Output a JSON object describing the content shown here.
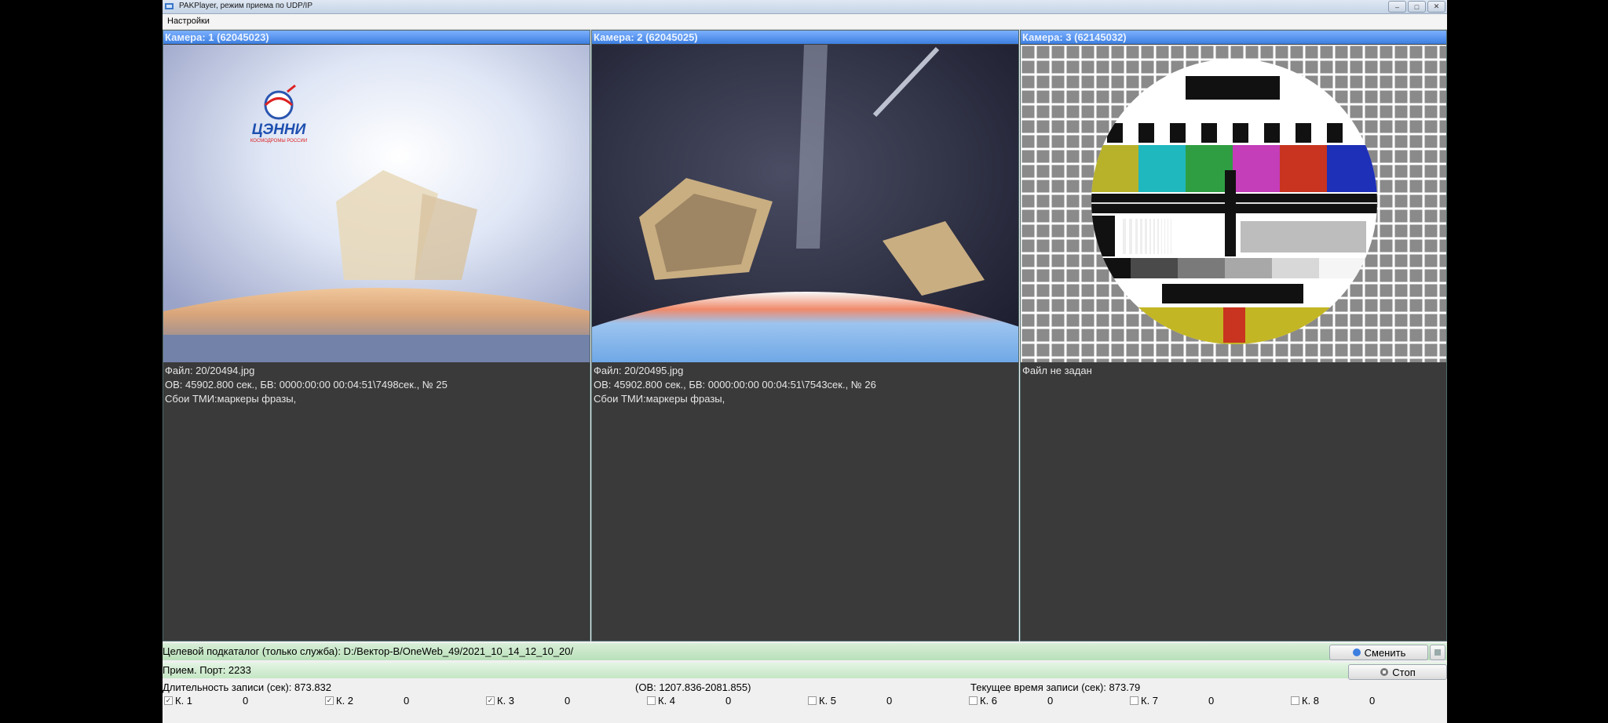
{
  "window": {
    "title": "PAKPlayer, режим приема по UDP/IP",
    "menu": [
      "Настройки"
    ]
  },
  "cameras": [
    {
      "header": "Камера: 1 (62045023)",
      "logo_text": "ЦЭННИ",
      "logo_subtext": "КОСМОДРОМЫ РОССИИ",
      "lines": [
        "Файл: 20/20494.jpg",
        "ОВ: 45902.800 сек., БВ: 0000:00:00 00:04:51\\7498сек., № 25",
        "Сбои ТМИ:маркеры фразы,"
      ]
    },
    {
      "header": "Камера: 2 (62045025)",
      "lines": [
        "Файл: 20/20495.jpg",
        "ОВ: 45902.800 сек., БВ: 0000:00:00 00:04:51\\7543сек., № 26",
        "Сбои ТМИ:маркеры фразы,"
      ]
    },
    {
      "header": "Камера: 3 (62145032)",
      "lines": [
        "Файл не задан"
      ]
    }
  ],
  "bottom": {
    "path_label": "Целевой подкаталог (только служба): D:/Вектор-В/OneWeb_49/2021_10_14_12_10_20/",
    "change_button": "Сменить",
    "port_label": "Прием. Порт: 2233",
    "stop_button": "Стоп",
    "duration": "Длительность записи (сек): 873.832",
    "ov_range": "(ОВ: 1207.836-2081.855)",
    "current_time": "Текущее время записи (сек): 873.79",
    "channels": [
      {
        "label": "К. 1",
        "checked": true,
        "value": "0"
      },
      {
        "label": "К. 2",
        "checked": true,
        "value": "0"
      },
      {
        "label": "К. 3",
        "checked": true,
        "value": "0"
      },
      {
        "label": "К. 4",
        "checked": false,
        "value": "0"
      },
      {
        "label": "К. 5",
        "checked": false,
        "value": "0"
      },
      {
        "label": "К. 6",
        "checked": false,
        "value": "0"
      },
      {
        "label": "К. 7",
        "checked": false,
        "value": "0"
      },
      {
        "label": "К. 8",
        "checked": false,
        "value": "0"
      }
    ]
  }
}
